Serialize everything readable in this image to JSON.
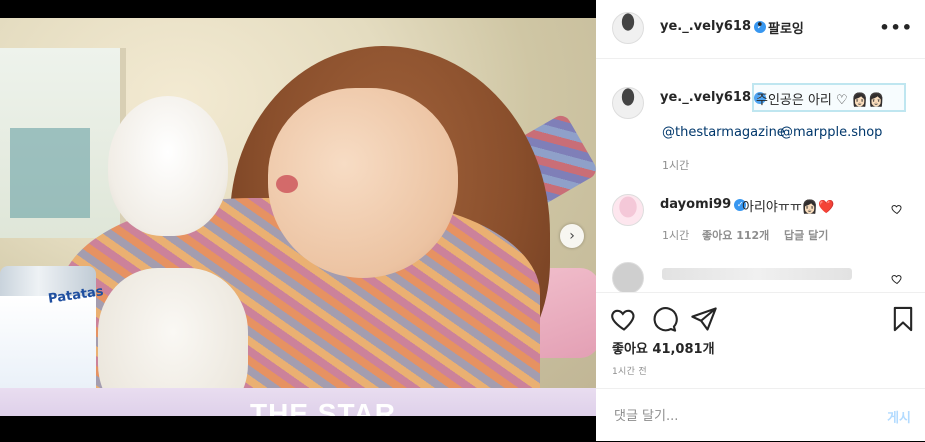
{
  "header": {
    "username": "ye._.vely618",
    "separator": "•",
    "follow_label": "팔로잉",
    "more_label": "•••"
  },
  "photo": {
    "brand_on_can": "Patatas",
    "watermark": "THE STAR",
    "next_label": "›"
  },
  "caption": {
    "username": "ye._.vely618",
    "text": "주인공은 아리 ♡ 👩🏻👩🏻",
    "mentions": [
      "@thestarmagazine",
      "@marpple.shop"
    ],
    "time": "1시간"
  },
  "comments": [
    {
      "username": "dayomi99",
      "text": "아리야ㅠㅠ👩🏻❤️",
      "time": "1시간",
      "likes": "좋아요 112개",
      "reply": "답글 달기"
    }
  ],
  "engagement": {
    "likes": "좋아요 41,081개",
    "time": "1시간 전"
  },
  "add_comment": {
    "placeholder": "댓글 달기...",
    "post_label": "게시"
  },
  "colors": {
    "verified": "#3897f0",
    "mention": "#00376b",
    "post_disabled": "#b3dbff",
    "caption_highlight": "#bfe6f0"
  }
}
